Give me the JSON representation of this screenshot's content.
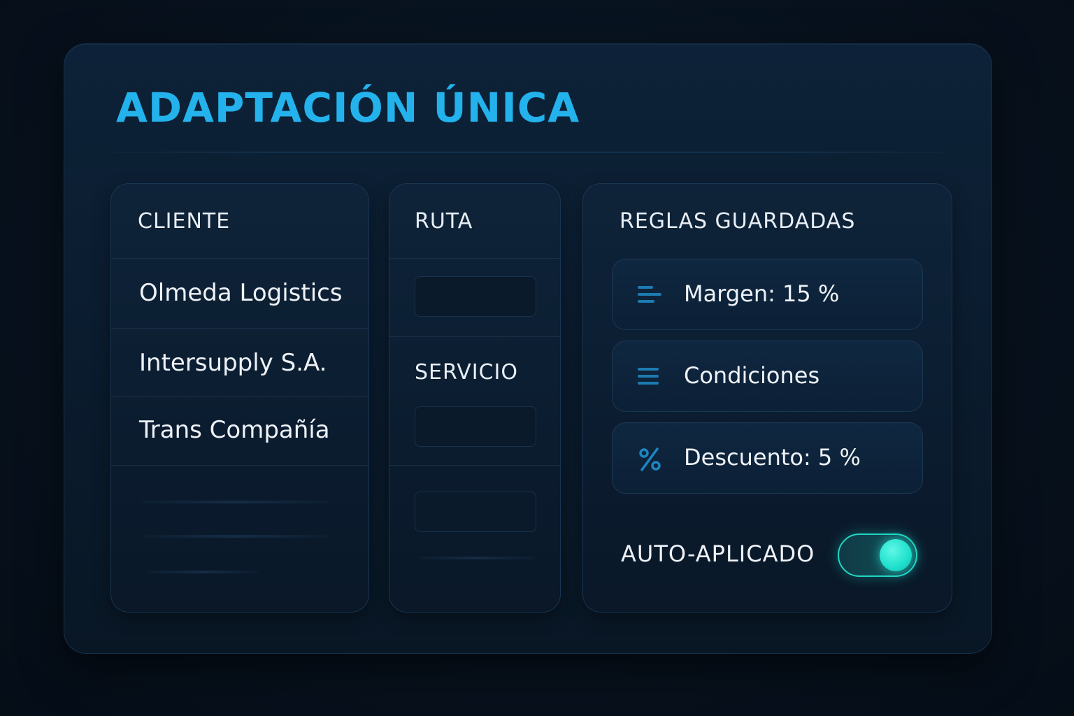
{
  "title": "ADAPTACIÓN ÚNICA",
  "cliente": {
    "header": "CLIENTE",
    "items": [
      "Olmeda Logistics",
      "Intersupply S.A.",
      "Trans Compañía"
    ]
  },
  "ruta": {
    "header": "RUTA",
    "servicio_header": "SERVICIO"
  },
  "reglas": {
    "header": "REGLAS GUARDADAS",
    "items": [
      {
        "label": "Margen: 15 %",
        "icon": "lines-icon"
      },
      {
        "label": "Condiciones",
        "icon": "list-icon"
      },
      {
        "label": "Descuento: 5 %",
        "icon": "percent-icon"
      }
    ],
    "auto_label": "AUTO-APLICADO",
    "auto_enabled": true
  },
  "colors": {
    "accent": "#23b2ec",
    "toggle": "#1ee0cc",
    "background": "#07121f"
  }
}
